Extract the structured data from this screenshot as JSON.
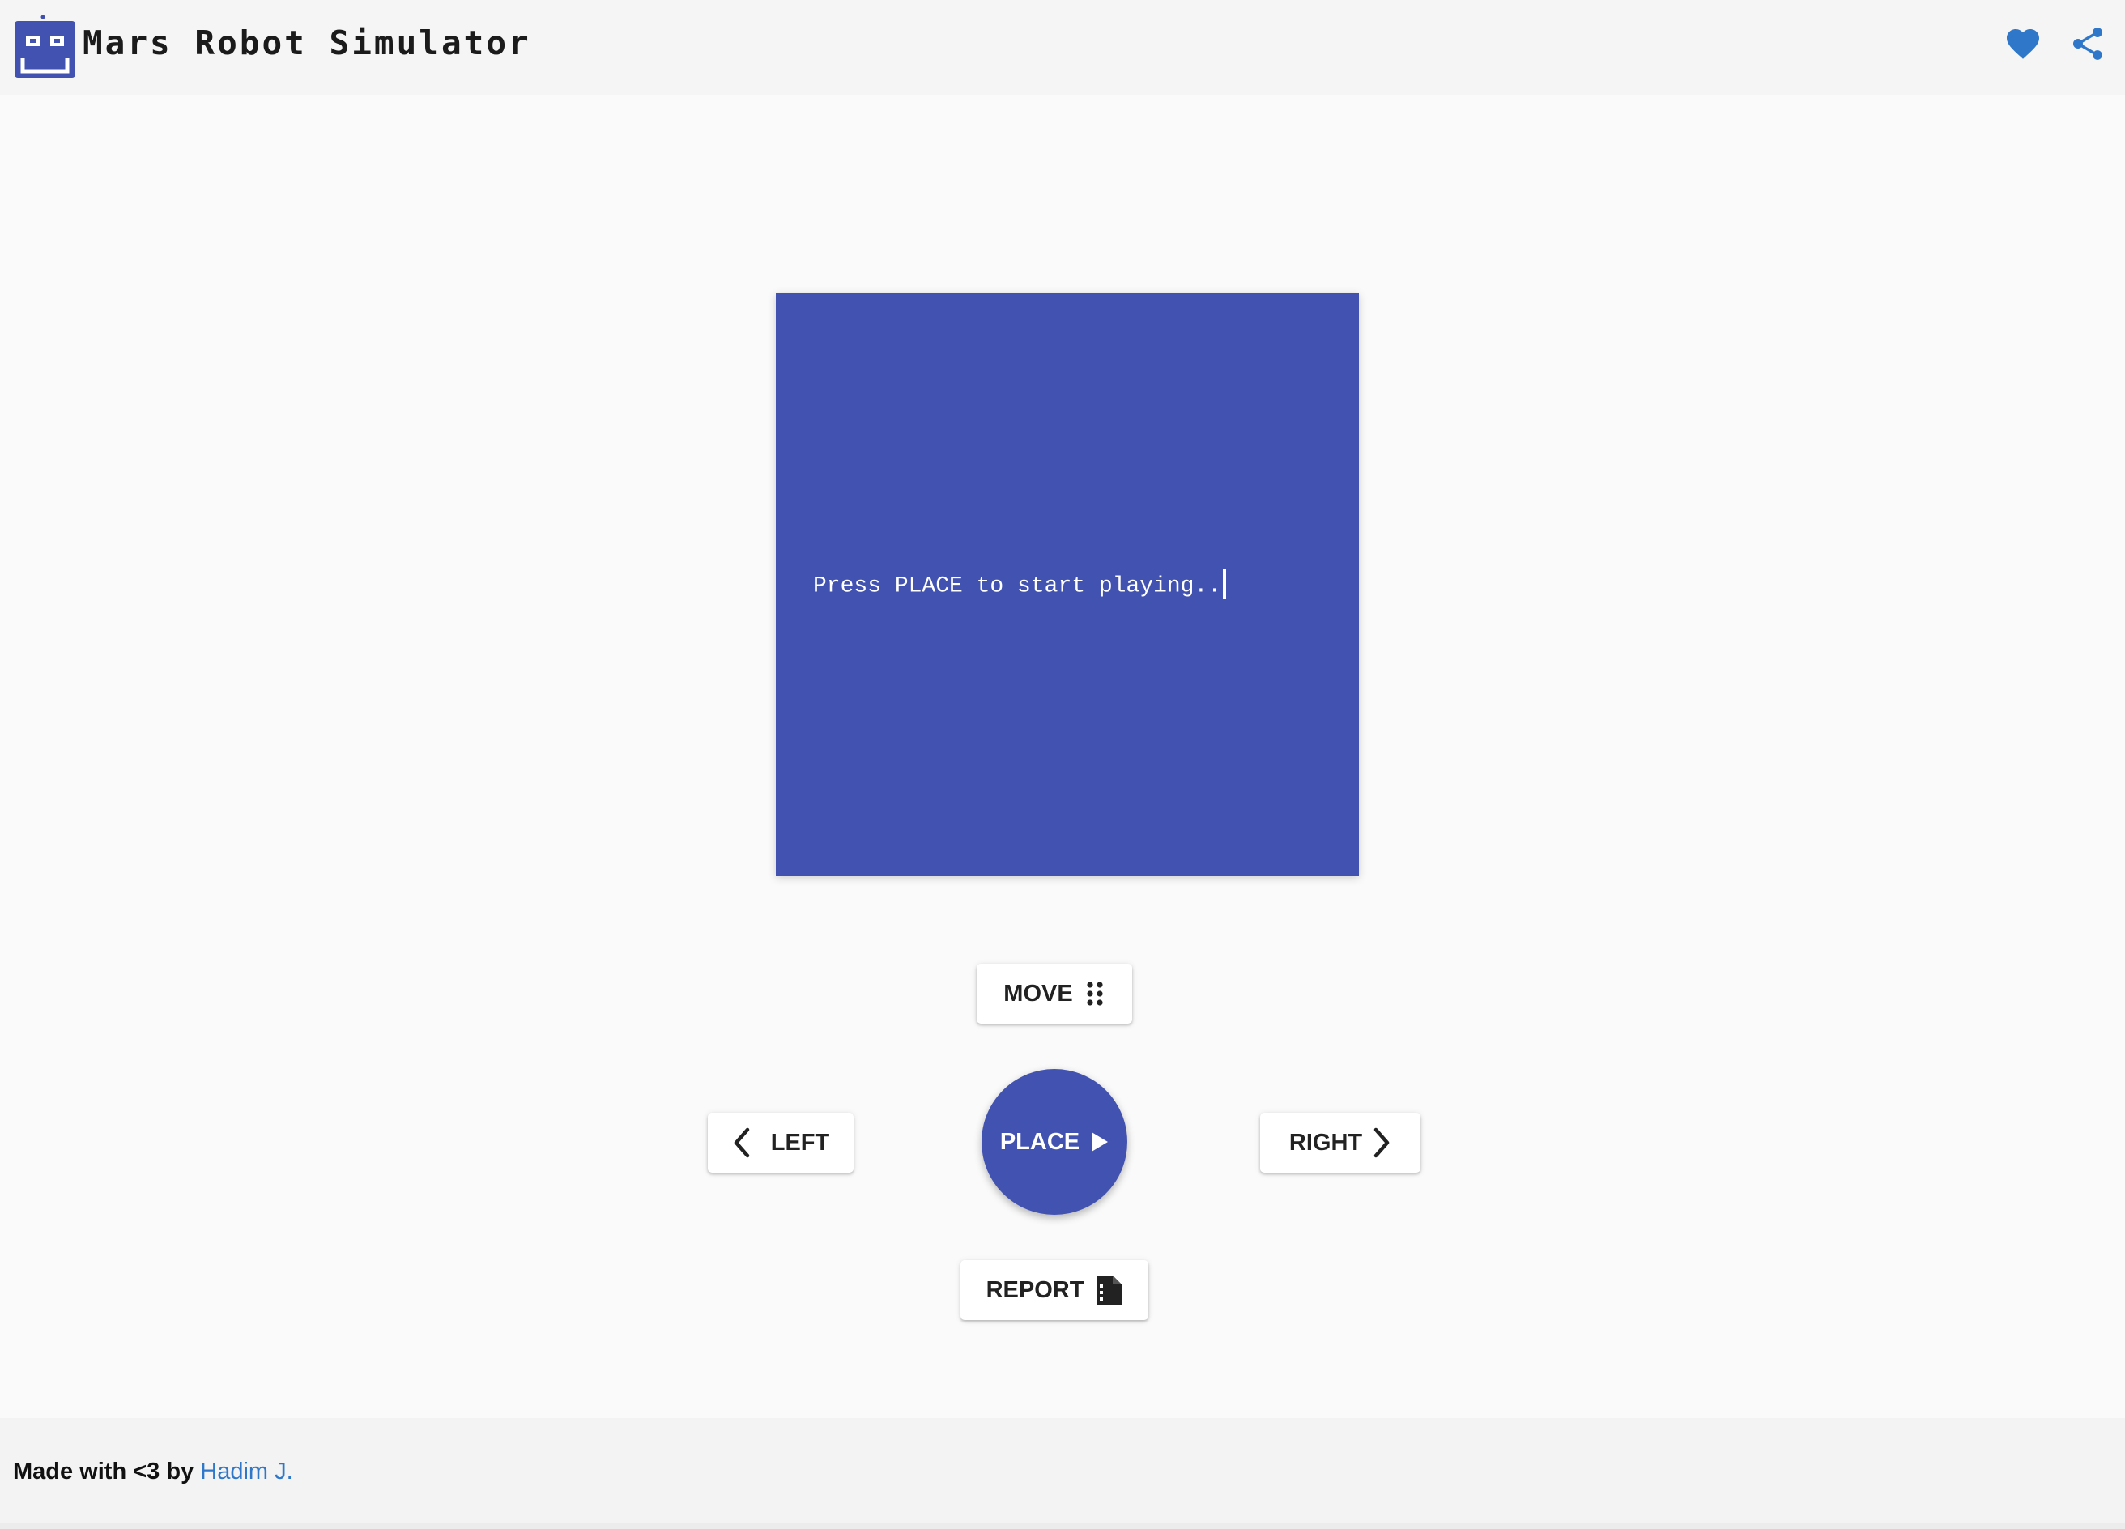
{
  "header": {
    "title": "Mars Robot Simulator",
    "logo_icon": "robot-icon",
    "actions": [
      {
        "icon": "heart-icon",
        "color": "#2f77c9"
      },
      {
        "icon": "share-icon",
        "color": "#2f77c9"
      }
    ]
  },
  "screen": {
    "message": "Press PLACE to start playing..",
    "background": "#4252b1"
  },
  "controls": {
    "move_label": "MOVE",
    "move_icon": "grid-dots-icon",
    "left_label": "LEFT",
    "left_icon": "chevron-left-icon",
    "place_label": "PLACE",
    "place_icon": "play-icon",
    "right_label": "RIGHT",
    "right_icon": "chevron-right-icon",
    "report_label": "REPORT",
    "report_icon": "file-report-icon"
  },
  "footer": {
    "prefix": "Made with <3 by ",
    "author": "Hadim J."
  },
  "colors": {
    "accent": "#4252b1",
    "link": "#2f77c9"
  }
}
